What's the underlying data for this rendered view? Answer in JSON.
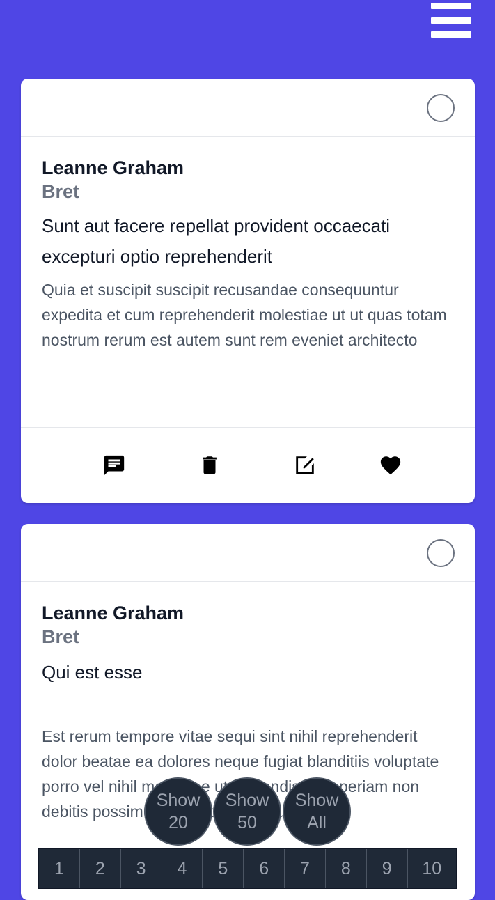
{
  "header": {
    "menu_icon": "hamburger-menu-icon",
    "background": "#4f46e5"
  },
  "posts": [
    {
      "author": "Leanne Graham",
      "username": "Bret",
      "title": "Sunt aut facere repellat provident occaecati excepturi optio reprehenderit",
      "body": "Quia et suscipit suscipit recusandae consequuntur expedita et cum reprehenderit molestiae ut ut quas totam nostrum rerum est autem sunt rem eveniet architecto",
      "actions": [
        "comment-icon",
        "trash-icon",
        "edit-icon",
        "heart-icon"
      ]
    },
    {
      "author": "Leanne Graham",
      "username": "Bret",
      "title": "Qui est esse",
      "body": "Est rerum tempore vitae sequi sint nihil reprehenderit dolor beatae ea dolores neque fugiat blanditiis voluptate porro vel nihil molestiae ut reiciendis qui aperiam non debitis possimus qui neque nisi nulla"
    }
  ],
  "page_size": {
    "show20": [
      "Show",
      "20"
    ],
    "show50": [
      "Show",
      "50"
    ],
    "showAll": [
      "Show",
      "All"
    ]
  },
  "pagination": [
    "1",
    "2",
    "3",
    "4",
    "5",
    "6",
    "7",
    "8",
    "9",
    "10"
  ]
}
